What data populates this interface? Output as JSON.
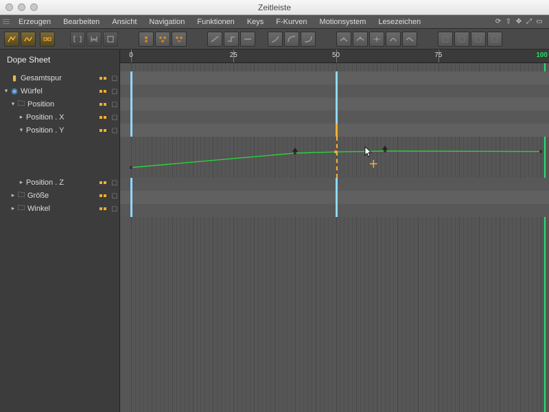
{
  "window": {
    "title": "Zeitleiste"
  },
  "menu": {
    "items": [
      "Erzeugen",
      "Bearbeiten",
      "Ansicht",
      "Navigation",
      "Funktionen",
      "Keys",
      "F-Kurven",
      "Motionsystem",
      "Lesezeichen"
    ]
  },
  "panel": {
    "title": "Dope Sheet"
  },
  "tree": {
    "master": {
      "label": "Gesamtspur"
    },
    "cube": {
      "label": "Würfel"
    },
    "position": {
      "label": "Position"
    },
    "posx": {
      "label": "Position . X"
    },
    "posy": {
      "label": "Position . Y"
    },
    "posz": {
      "label": "Position . Z"
    },
    "size": {
      "label": "Größe"
    },
    "angle": {
      "label": "Winkel"
    }
  },
  "ruler": {
    "ticks": [
      {
        "frame": 0,
        "label": "0"
      },
      {
        "frame": 25,
        "label": "25"
      },
      {
        "frame": 50,
        "label": "50"
      },
      {
        "frame": 75,
        "label": "75"
      }
    ],
    "end_label": "100",
    "range": 100
  },
  "keys": {
    "common_frames": [
      0,
      50
    ],
    "posy_selected_frame": 50,
    "curve_points": [
      {
        "frame": 0,
        "y": 0.75
      },
      {
        "frame": 40,
        "y": 0.4
      },
      {
        "frame": 50,
        "y": 0.37
      },
      {
        "frame": 62,
        "y": 0.35
      },
      {
        "frame": 100,
        "y": 0.36
      }
    ]
  },
  "cursor": {
    "frame": 57,
    "plus_frame": 58
  },
  "colors": {
    "accent": "#ffb030",
    "key_blue": "#8fd9ff",
    "curve_green": "#28d43a",
    "end_green": "#22e060"
  }
}
